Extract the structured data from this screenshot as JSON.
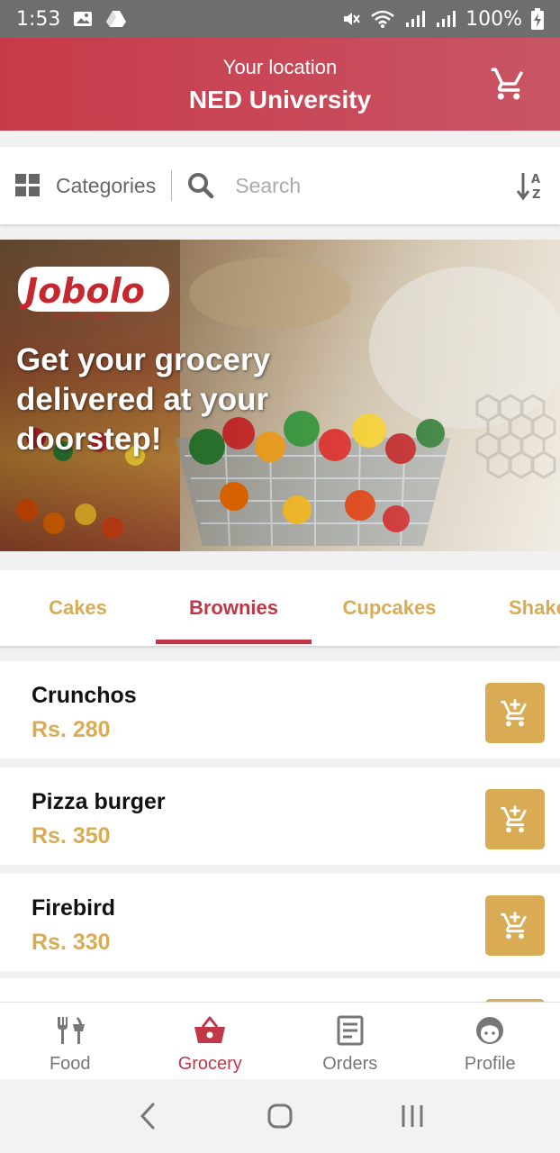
{
  "status_bar": {
    "time": "1:53",
    "battery": "100%",
    "icons": [
      "image-icon",
      "drive-icon",
      "mute-icon",
      "wifi-icon",
      "signal-icon",
      "signal-icon",
      "battery-charging-icon"
    ]
  },
  "header": {
    "location_label": "Your location",
    "location_value": "NED University",
    "cart_icon": "cart-icon"
  },
  "search_bar": {
    "categories_label": "Categories",
    "search_placeholder": "Search",
    "sort_icon": "sort-az-icon"
  },
  "banner": {
    "logo_text": "Jobolo",
    "logo_tagline": "Hum Hain Na !",
    "headline": "Get your grocery delivered at your doorstep!"
  },
  "tabs": {
    "active_index": 1,
    "items": [
      {
        "label": "Cakes"
      },
      {
        "label": "Brownies"
      },
      {
        "label": "Cupcakes"
      },
      {
        "label": "Shakes"
      }
    ]
  },
  "products": [
    {
      "name": "Crunchos",
      "price": "Rs. 280"
    },
    {
      "name": "Pizza burger",
      "price": "Rs. 350"
    },
    {
      "name": "Firebird",
      "price": "Rs. 330"
    }
  ],
  "bottom_nav": {
    "active_index": 1,
    "items": [
      {
        "label": "Food",
        "icon": "fork-knife-icon"
      },
      {
        "label": "Grocery",
        "icon": "basket-icon"
      },
      {
        "label": "Orders",
        "icon": "receipt-icon"
      },
      {
        "label": "Profile",
        "icon": "profile-icon"
      }
    ]
  },
  "colors": {
    "brand_red": "#c73a49",
    "accent_gold": "#d9ab55",
    "status_bar": "#6e6e6e"
  }
}
